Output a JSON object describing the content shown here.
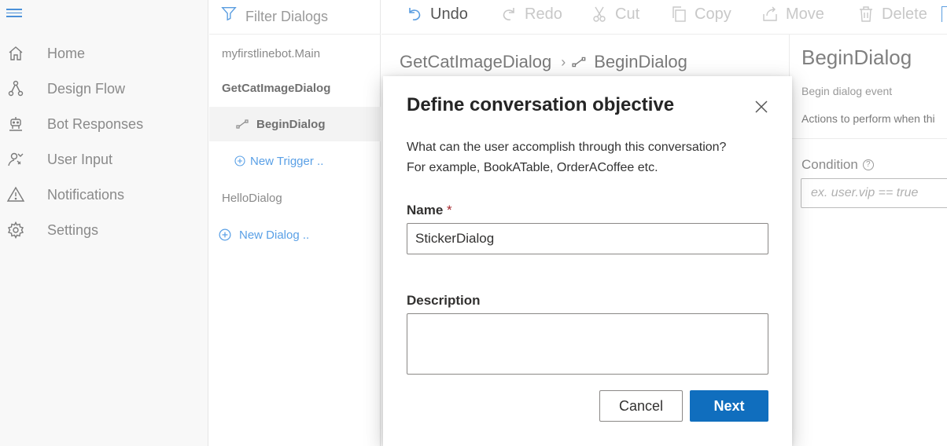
{
  "nav": {
    "items": [
      {
        "label": "Home",
        "icon": "home-icon"
      },
      {
        "label": "Design Flow",
        "icon": "flow-icon"
      },
      {
        "label": "Bot Responses",
        "icon": "bot-icon"
      },
      {
        "label": "User Input",
        "icon": "user-input-icon"
      },
      {
        "label": "Notifications",
        "icon": "warning-icon"
      },
      {
        "label": "Settings",
        "icon": "gear-icon"
      }
    ]
  },
  "dialogs": {
    "filter_placeholder": "Filter Dialogs",
    "items": [
      {
        "label": "myfirstlinebot.Main"
      },
      {
        "label": "GetCatImageDialog"
      },
      {
        "label": "BeginDialog"
      },
      {
        "label": "New Trigger .."
      },
      {
        "label": "HelloDialog"
      },
      {
        "label": "New Dialog .."
      }
    ]
  },
  "toolbar": {
    "undo": "Undo",
    "redo": "Redo",
    "cut": "Cut",
    "copy": "Copy",
    "move": "Move",
    "delete": "Delete"
  },
  "breadcrumb": {
    "dialog": "GetCatImageDialog",
    "trigger": "BeginDialog"
  },
  "properties": {
    "title": "BeginDialog",
    "subtitle": "Begin dialog event",
    "description": "Actions to perform when thi",
    "condition_label": "Condition",
    "condition_placeholder": "ex. user.vip == true"
  },
  "modal": {
    "title": "Define conversation objective",
    "text_line1": "What can the user accomplish through this conversation?",
    "text_line2": "For example, BookATable, OrderACoffee etc.",
    "name_label": "Name",
    "name_required": "*",
    "name_value": "StickerDialog",
    "description_label": "Description",
    "description_value": "",
    "cancel": "Cancel",
    "next": "Next"
  },
  "colors": {
    "accent": "#106ebe",
    "link": "#5aa0e6",
    "nav_bg": "#f8f8f8"
  }
}
